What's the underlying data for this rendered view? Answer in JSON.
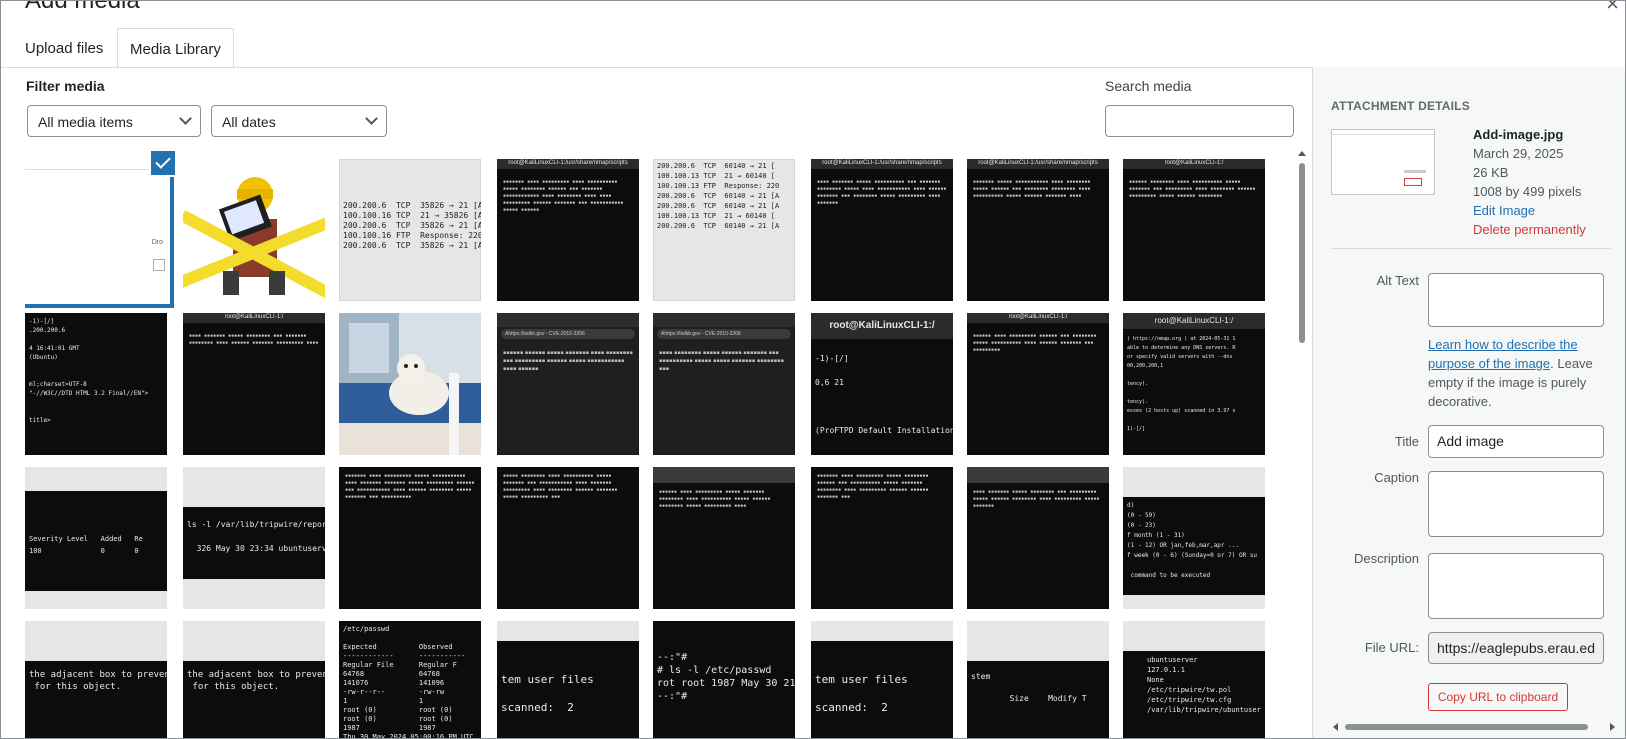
{
  "modal": {
    "title": "Add media",
    "close": "×"
  },
  "tabs": [
    {
      "label": "Upload files"
    },
    {
      "label": "Media Library"
    }
  ],
  "filter": {
    "label": "Filter media",
    "type_select": "All media items",
    "date_select": "All dates",
    "search_label": "Search media"
  },
  "tiles": {
    "t0": {
      "text": "Dro"
    },
    "t2": {
      "text": "200.200.6  TCP  35826 → 21 [A\n100.100.16 TCP  21 → 35826 [A\n200.200.6  TCP  35826 → 21 [A\n100.100.16 FTP  Response: 220\n200.200.6  TCP  35826 → 21 [A"
    },
    "t3": {
      "title": "root@KaliLinuxCLI-1:/usr/share/nmap/scripts"
    },
    "t4": {
      "text": "200.200.6  TCP  60140 → 21 [\n100.100.13 TCP  21 → 60140 [\n100.100.13 FTP  Response: 220\n200.200.6  TCP  60140 → 21 [A\n200.200.6  TCP  60140 → 21 [A\n100.100.13 TCP  21 → 60140 [\n200.200.6  TCP  60140 → 21 [A"
    },
    "t5": {
      "title": "root@KaliLinuxCLI-1:/usr/share/nmap/scripts"
    },
    "t6": {
      "title": "root@KaliLinuxCLI-1:/usr/share/nmap/scripts"
    },
    "t7": {
      "title": "root@KaliLinuxCLI-1:/"
    },
    "t8": {
      "text": "-1)-[/]\n.200.200.6\n\n4 16:41:01 GMT\n(Ubuntu)\n\n\nml;charset=UTF-8\n\"-//W3C//DTD HTML 3.2 Final//EN\">\n\n\ntitle>"
    },
    "t9": {
      "title": "root@KaliLinuxCLI-1:/"
    },
    "t11": {
      "text": "Ahttps://lsdkb.gov - CVE-2015-3306"
    },
    "t12": {
      "text": "Ahttps://lsdkb.gov - CVE-2015-3306"
    },
    "t13": {
      "title": "root@KaliLinuxCLI-1:/",
      "text": "-1)-[/]\n\n0,6 21\n\n\n\n(ProFTPD Default Installation) ["
    },
    "t14": {
      "title": "root@KaliLinuxCLI-1:/"
    },
    "t15": {
      "title": "root@KaliLinuxCLI-1:/",
      "text": "( https://nmap.org ) at 2024-05-31 1\nable to determine any DNS servers. R\nor specify valid servers with --dns\n00,200,200,1\n\ntency).\n\ntency).\nesses (2 hosts up) scanned in 3.97 s\n\n1)-[/]"
    },
    "t16": {
      "text": "Severity Level   Added   Re\n100              0       0"
    },
    "t17": {
      "text": "ls -l /var/lib/tripwire/report/\n\n  326 May 30 23:34 ubuntuserver"
    },
    "t18": {
      "text": ""
    },
    "t19": {
      "text": ""
    },
    "t20": {
      "text": ""
    },
    "t21": {
      "text": ""
    },
    "t22": {
      "text": ""
    },
    "t23": {
      "text": "d)\n(0 - 59)\n(0 - 23)\nf month (1 - 31)\n(1 - 12) OR jan,feb,mar,apr ...\nf week (0 - 6) (Sunday=0 or 7) OR su\n\n command to be executed"
    },
    "t24": {
      "text": "the adjacent box to prevent up\n for this object."
    },
    "t25": {
      "text": "the adjacent box to prevent up\n for this object."
    },
    "t26": {
      "text": "/etc/passwd\n\nExpected          Observed\n------------      -----------\nRegular File      Regular F\n64768             64768\n141076            141096\n-rw-r--r--        -rw-rw\n1                 1\nroot (0)          root (0)\nroot (0)          root (0)\n1987              1987\nThu 30 May 2024 05:00:16 PM UTC"
    },
    "t27": {
      "text": "                       S\n\ntem user files         1\n\nscanned:  2"
    },
    "t28": {
      "text": "--:\"#\n# ls -l /etc/passwd\nrot root 1987 May 30 21:\n--:\"#"
    },
    "t29": {
      "text": "                       S\n\ntem user files         1\n\nscanned:  2"
    },
    "t30": {
      "text": "stem\n\n        Size    Modify T\n\n\n"
    },
    "t31": {
      "text": "ubuntuserver\n127.0.1.1\nNone\n/etc/tripwire/tw.pol\n/etc/tripwire/tw.cfg\n/var/lib/tripwire/ubuntuser"
    }
  },
  "details": {
    "heading": "ATTACHMENT DETAILS",
    "filename": "Add-image.jpg",
    "date": "March 29, 2025",
    "size": "26 KB",
    "dimensions": "1008 by 499 pixels",
    "edit": "Edit Image",
    "delete": "Delete permanently",
    "alt_label": "Alt Text",
    "alt_link": "Learn how to describe the purpose of the image",
    "alt_note": ". Leave empty if the image is purely decorative.",
    "title_label": "Title",
    "title_value": "Add image",
    "caption_label": "Caption",
    "description_label": "Description",
    "url_label": "File URL:",
    "url_value": "https://eaglepubs.erau.ed",
    "copy": "Copy URL to clipboard"
  },
  "colors": {
    "accent": "#2271b1",
    "danger": "#d63638",
    "terminal": "#0c0c0c"
  }
}
